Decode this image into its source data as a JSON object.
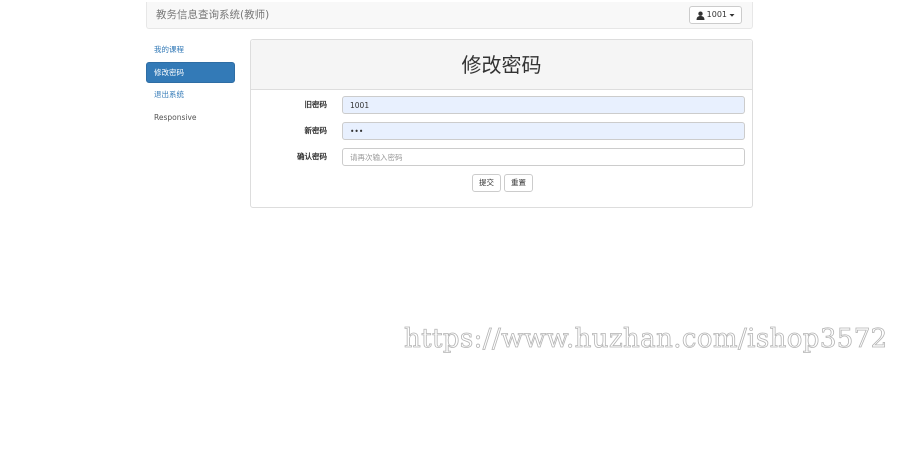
{
  "navbar": {
    "brand": "教务信息查询系统(教师)",
    "user_label": "1001",
    "user_icon": "user-icon",
    "caret_icon": "caret-down-icon"
  },
  "sidebar": {
    "items": [
      {
        "label": "我的课程",
        "active": false
      },
      {
        "label": "修改密码",
        "active": true
      },
      {
        "label": "退出系统",
        "active": false
      },
      {
        "label": "Responsive",
        "active": false
      }
    ]
  },
  "panel": {
    "title": "修改密码",
    "fields": [
      {
        "label": "旧密码",
        "value": "1001",
        "placeholder": ""
      },
      {
        "label": "新密码",
        "value": "•••",
        "placeholder": ""
      },
      {
        "label": "确认密码",
        "value": "",
        "placeholder": "请再次输入密码"
      }
    ],
    "submit_label": "提交",
    "reset_label": "重置"
  },
  "watermark": "https://www.huzhan.com/ishop3572",
  "colors": {
    "primary": "#337ab7",
    "navbar_bg": "#f8f8f8",
    "panel_heading_bg": "#f5f5f5",
    "autofill_bg": "#e8f0fe"
  }
}
